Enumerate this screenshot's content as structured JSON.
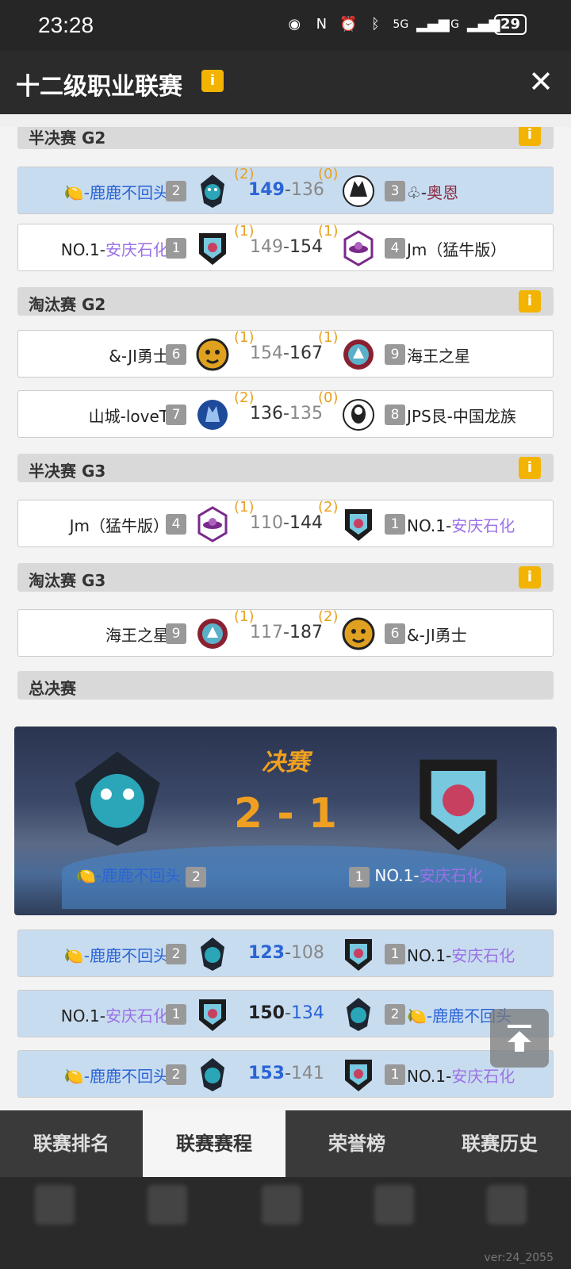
{
  "status_bar": {
    "time": "23:28",
    "network1": "5G",
    "network2": "5G",
    "battery": "29"
  },
  "header": {
    "title": "十二级职业联赛",
    "info_label": "i",
    "close_label": "✕"
  },
  "sections": [
    {
      "label": "半决赛 G2",
      "info": "i"
    },
    {
      "label": "淘汰赛 G2",
      "info": "i"
    },
    {
      "label": "半决赛 G3",
      "info": "i"
    },
    {
      "label": "淘汰赛 G3",
      "info": "i"
    },
    {
      "label": "总决赛",
      "info": ""
    }
  ],
  "matches": [
    {
      "left_prefix": "🍋-",
      "left_name": "鹿鹿不回头",
      "left_seed": "2",
      "left_wins": "(2)",
      "left_score": "149",
      "sep": "-",
      "right_score": "136",
      "right_wins": "(0)",
      "right_seed": "3",
      "right_prefix": "♧-",
      "right_name": "奥恩"
    },
    {
      "left_prefix": "NO.1-",
      "left_name": "安庆石化",
      "left_seed": "1",
      "left_wins": "(1)",
      "left_score": "149",
      "sep": "-",
      "right_score": "154",
      "right_wins": "(1)",
      "right_seed": "4",
      "right_prefix": "",
      "right_name": "Jm（猛牛版）"
    },
    {
      "left_prefix": "",
      "left_name": "&-JI勇士",
      "left_seed": "6",
      "left_wins": "(1)",
      "left_score": "154",
      "sep": "-",
      "right_score": "167",
      "right_wins": "(1)",
      "right_seed": "9",
      "right_prefix": "",
      "right_name": "海王之星"
    },
    {
      "left_prefix": "",
      "left_name": "山城-loveT",
      "left_seed": "7",
      "left_wins": "(2)",
      "left_score": "136",
      "sep": "-",
      "right_score": "135",
      "right_wins": "(0)",
      "right_seed": "8",
      "right_prefix": "",
      "right_name": "JPS艮-中国龙族"
    },
    {
      "left_prefix": "",
      "left_name": "Jm（猛牛版）",
      "left_seed": "4",
      "left_wins": "(1)",
      "left_score": "110",
      "sep": "-",
      "right_score": "144",
      "right_wins": "(2)",
      "right_seed": "1",
      "right_prefix": "NO.1-",
      "right_name": "安庆石化"
    },
    {
      "left_prefix": "",
      "left_name": "海王之星",
      "left_seed": "9",
      "left_wins": "(1)",
      "left_score": "117",
      "sep": "-",
      "right_score": "187",
      "right_wins": "(2)",
      "right_seed": "6",
      "right_prefix": "",
      "right_name": "&-JI勇士"
    }
  ],
  "finals": {
    "title": "决赛",
    "score": "2 - 1",
    "left_prefix": "🍋-",
    "left_name": "鹿鹿不回头",
    "left_seed": "2",
    "right_seed": "1",
    "right_prefix": "NO.1-",
    "right_name": "安庆石化"
  },
  "finals_games": [
    {
      "left_prefix": "🍋-",
      "left_name": "鹿鹿不回头",
      "left_seed": "2",
      "left_score": "123",
      "sep": "-",
      "right_score": "108",
      "right_seed": "1",
      "right_prefix": "NO.1-",
      "right_name": "安庆石化"
    },
    {
      "left_prefix": "NO.1-",
      "left_name": "安庆石化",
      "left_seed": "1",
      "left_score": "150",
      "sep": "-",
      "right_score": "134",
      "right_seed": "2",
      "right_prefix": "🍋-",
      "right_name": "鹿鹿不回头"
    },
    {
      "left_prefix": "🍋-",
      "left_name": "鹿鹿不回头",
      "left_seed": "2",
      "left_score": "153",
      "sep": "-",
      "right_score": "141",
      "right_seed": "1",
      "right_prefix": "NO.1-",
      "right_name": "安庆石化"
    }
  ],
  "tabs": [
    "联赛排名",
    "联赛赛程",
    "荣誉榜",
    "联赛历史"
  ],
  "active_tab": "联赛赛程",
  "version": "ver:24_2055",
  "colors": {
    "accent": "#f2b400",
    "win_score": "#2a64d6",
    "purple_name": "#9a70e6",
    "series_wins": "#e8a020"
  }
}
